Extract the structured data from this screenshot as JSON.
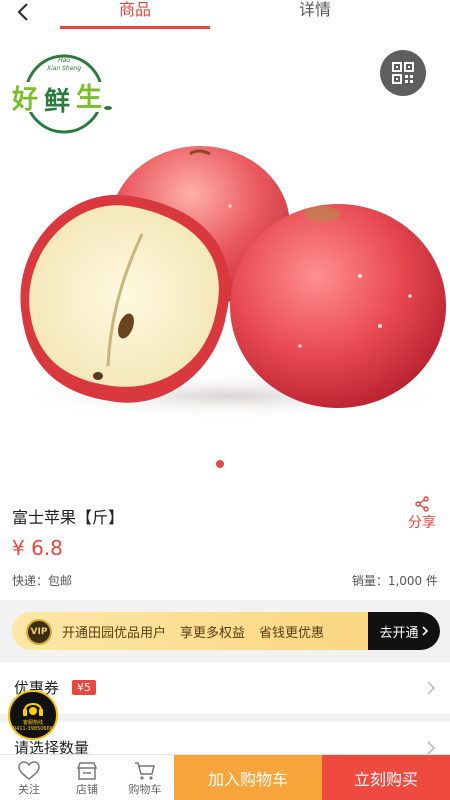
{
  "header": {
    "tabs": [
      {
        "label": "商品",
        "active": true
      },
      {
        "label": "详情",
        "active": false
      }
    ]
  },
  "logo": {
    "pinyin_top": "Hao",
    "pinyin_bottom": "Xian Sheng",
    "text": "好鲜生"
  },
  "gallery": {
    "active_index": 0,
    "count": 1
  },
  "product": {
    "name": "富士苹果【斤】",
    "price": "¥ 6.8",
    "shipping": "快递：包邮",
    "sales": "销量：1,000 件",
    "share_label": "分享"
  },
  "vip": {
    "badge": "VIP",
    "texts": [
      "开通田园优品用户",
      "享更多权益",
      "省钱更优惠"
    ],
    "cta": "去开通"
  },
  "coupon": {
    "label": "优惠券",
    "tag": "¥5"
  },
  "quantity": {
    "label": "请选择数量"
  },
  "service": {
    "title": "客服热线",
    "phone": "0411-39850666"
  },
  "bottom": {
    "favorite": "关注",
    "store": "店铺",
    "cart": "购物车",
    "add_to_cart": "加入购物车",
    "buy_now": "立刻购买"
  },
  "colors": {
    "accent": "#e8473d",
    "cart_button": "#f7a43b",
    "buy_button": "#ee4a3f",
    "vip_gold": "#f8d27a"
  }
}
